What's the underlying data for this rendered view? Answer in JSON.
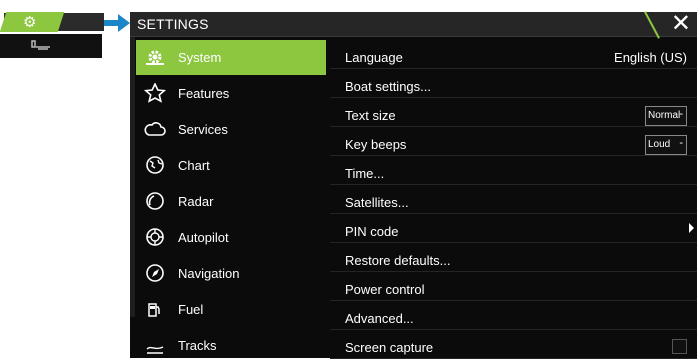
{
  "header": {
    "title": "SETTINGS"
  },
  "sidebar": {
    "items": [
      {
        "label": "System",
        "icon": "gear-icon"
      },
      {
        "label": "Features",
        "icon": "star-icon"
      },
      {
        "label": "Services",
        "icon": "cloud-icon"
      },
      {
        "label": "Chart",
        "icon": "globe-icon"
      },
      {
        "label": "Radar",
        "icon": "radar-icon"
      },
      {
        "label": "Autopilot",
        "icon": "autopilot-icon"
      },
      {
        "label": "Navigation",
        "icon": "compass-icon"
      },
      {
        "label": "Fuel",
        "icon": "fuel-icon"
      },
      {
        "label": "Tracks",
        "icon": "tracks-icon"
      }
    ]
  },
  "settings": {
    "language": {
      "label": "Language",
      "value": "English (US)"
    },
    "boat": {
      "label": "Boat settings..."
    },
    "text_size": {
      "label": "Text size",
      "value": "Normal"
    },
    "key_beeps": {
      "label": "Key beeps",
      "value": "Loud"
    },
    "time": {
      "label": "Time..."
    },
    "satellites": {
      "label": "Satellites..."
    },
    "pin": {
      "label": "PIN code"
    },
    "restore": {
      "label": "Restore defaults..."
    },
    "power": {
      "label": "Power control"
    },
    "advanced": {
      "label": "Advanced..."
    },
    "capture": {
      "label": "Screen capture"
    }
  },
  "colors": {
    "accent": "#8dc63f",
    "background": "#0b0b0b",
    "arrow": "#1b86c8"
  }
}
